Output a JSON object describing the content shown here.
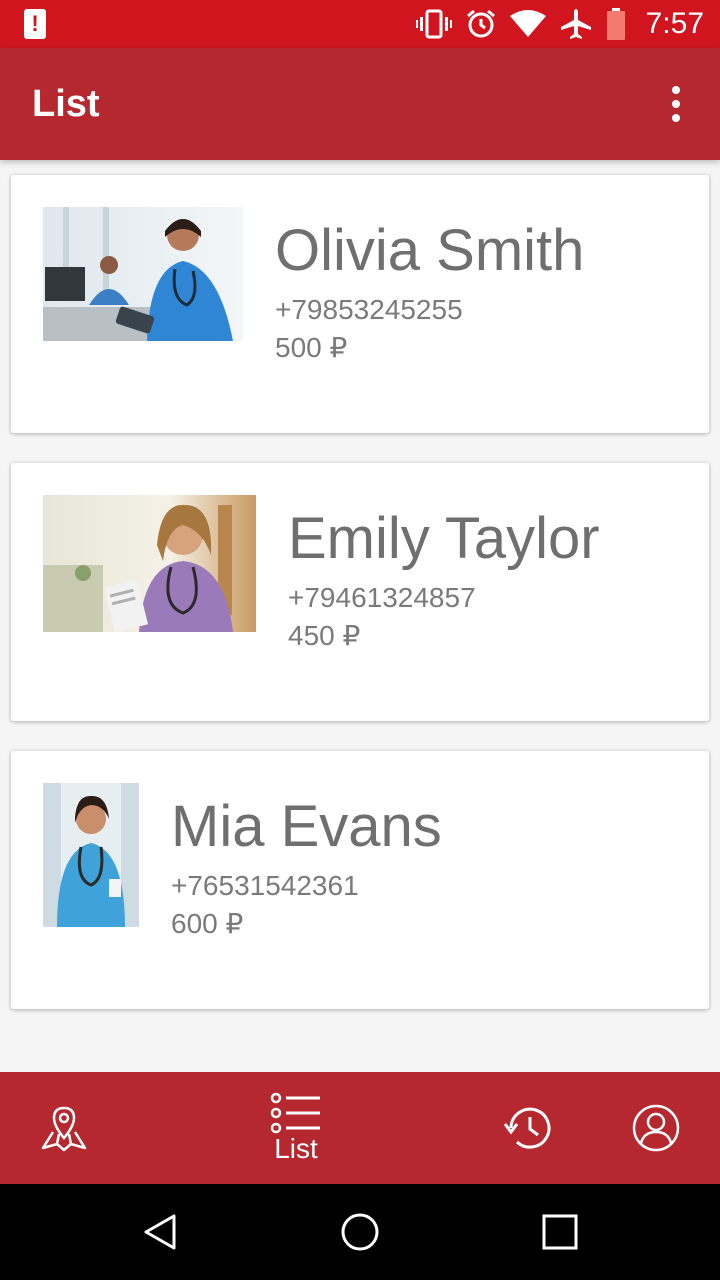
{
  "status_bar": {
    "time": "7:57",
    "icons": [
      "alert-icon",
      "vibrate-icon",
      "alarm-icon",
      "wifi-icon",
      "airplane-icon",
      "battery-icon"
    ]
  },
  "app_bar": {
    "title": "List",
    "overflow_icon": "more-vert-icon"
  },
  "contacts": [
    {
      "name": "Olivia Smith",
      "phone": "+79853245255",
      "price": "500 ₽"
    },
    {
      "name": "Emily Taylor",
      "phone": "+79461324857",
      "price": "450 ₽"
    },
    {
      "name": "Mia Evans",
      "phone": "+76531542361",
      "price": "600 ₽"
    }
  ],
  "bottom_nav": {
    "items": [
      {
        "icon": "map-pin-icon",
        "label": ""
      },
      {
        "icon": "list-icon",
        "label": "List",
        "active": true
      },
      {
        "icon": "history-icon",
        "label": ""
      },
      {
        "icon": "profile-icon",
        "label": ""
      }
    ]
  },
  "system_nav": [
    "back-icon",
    "home-icon",
    "recents-icon"
  ],
  "colors": {
    "status_bar": "#d0151f",
    "accent": "#b6282f",
    "text_secondary": "#7a7a7a"
  }
}
